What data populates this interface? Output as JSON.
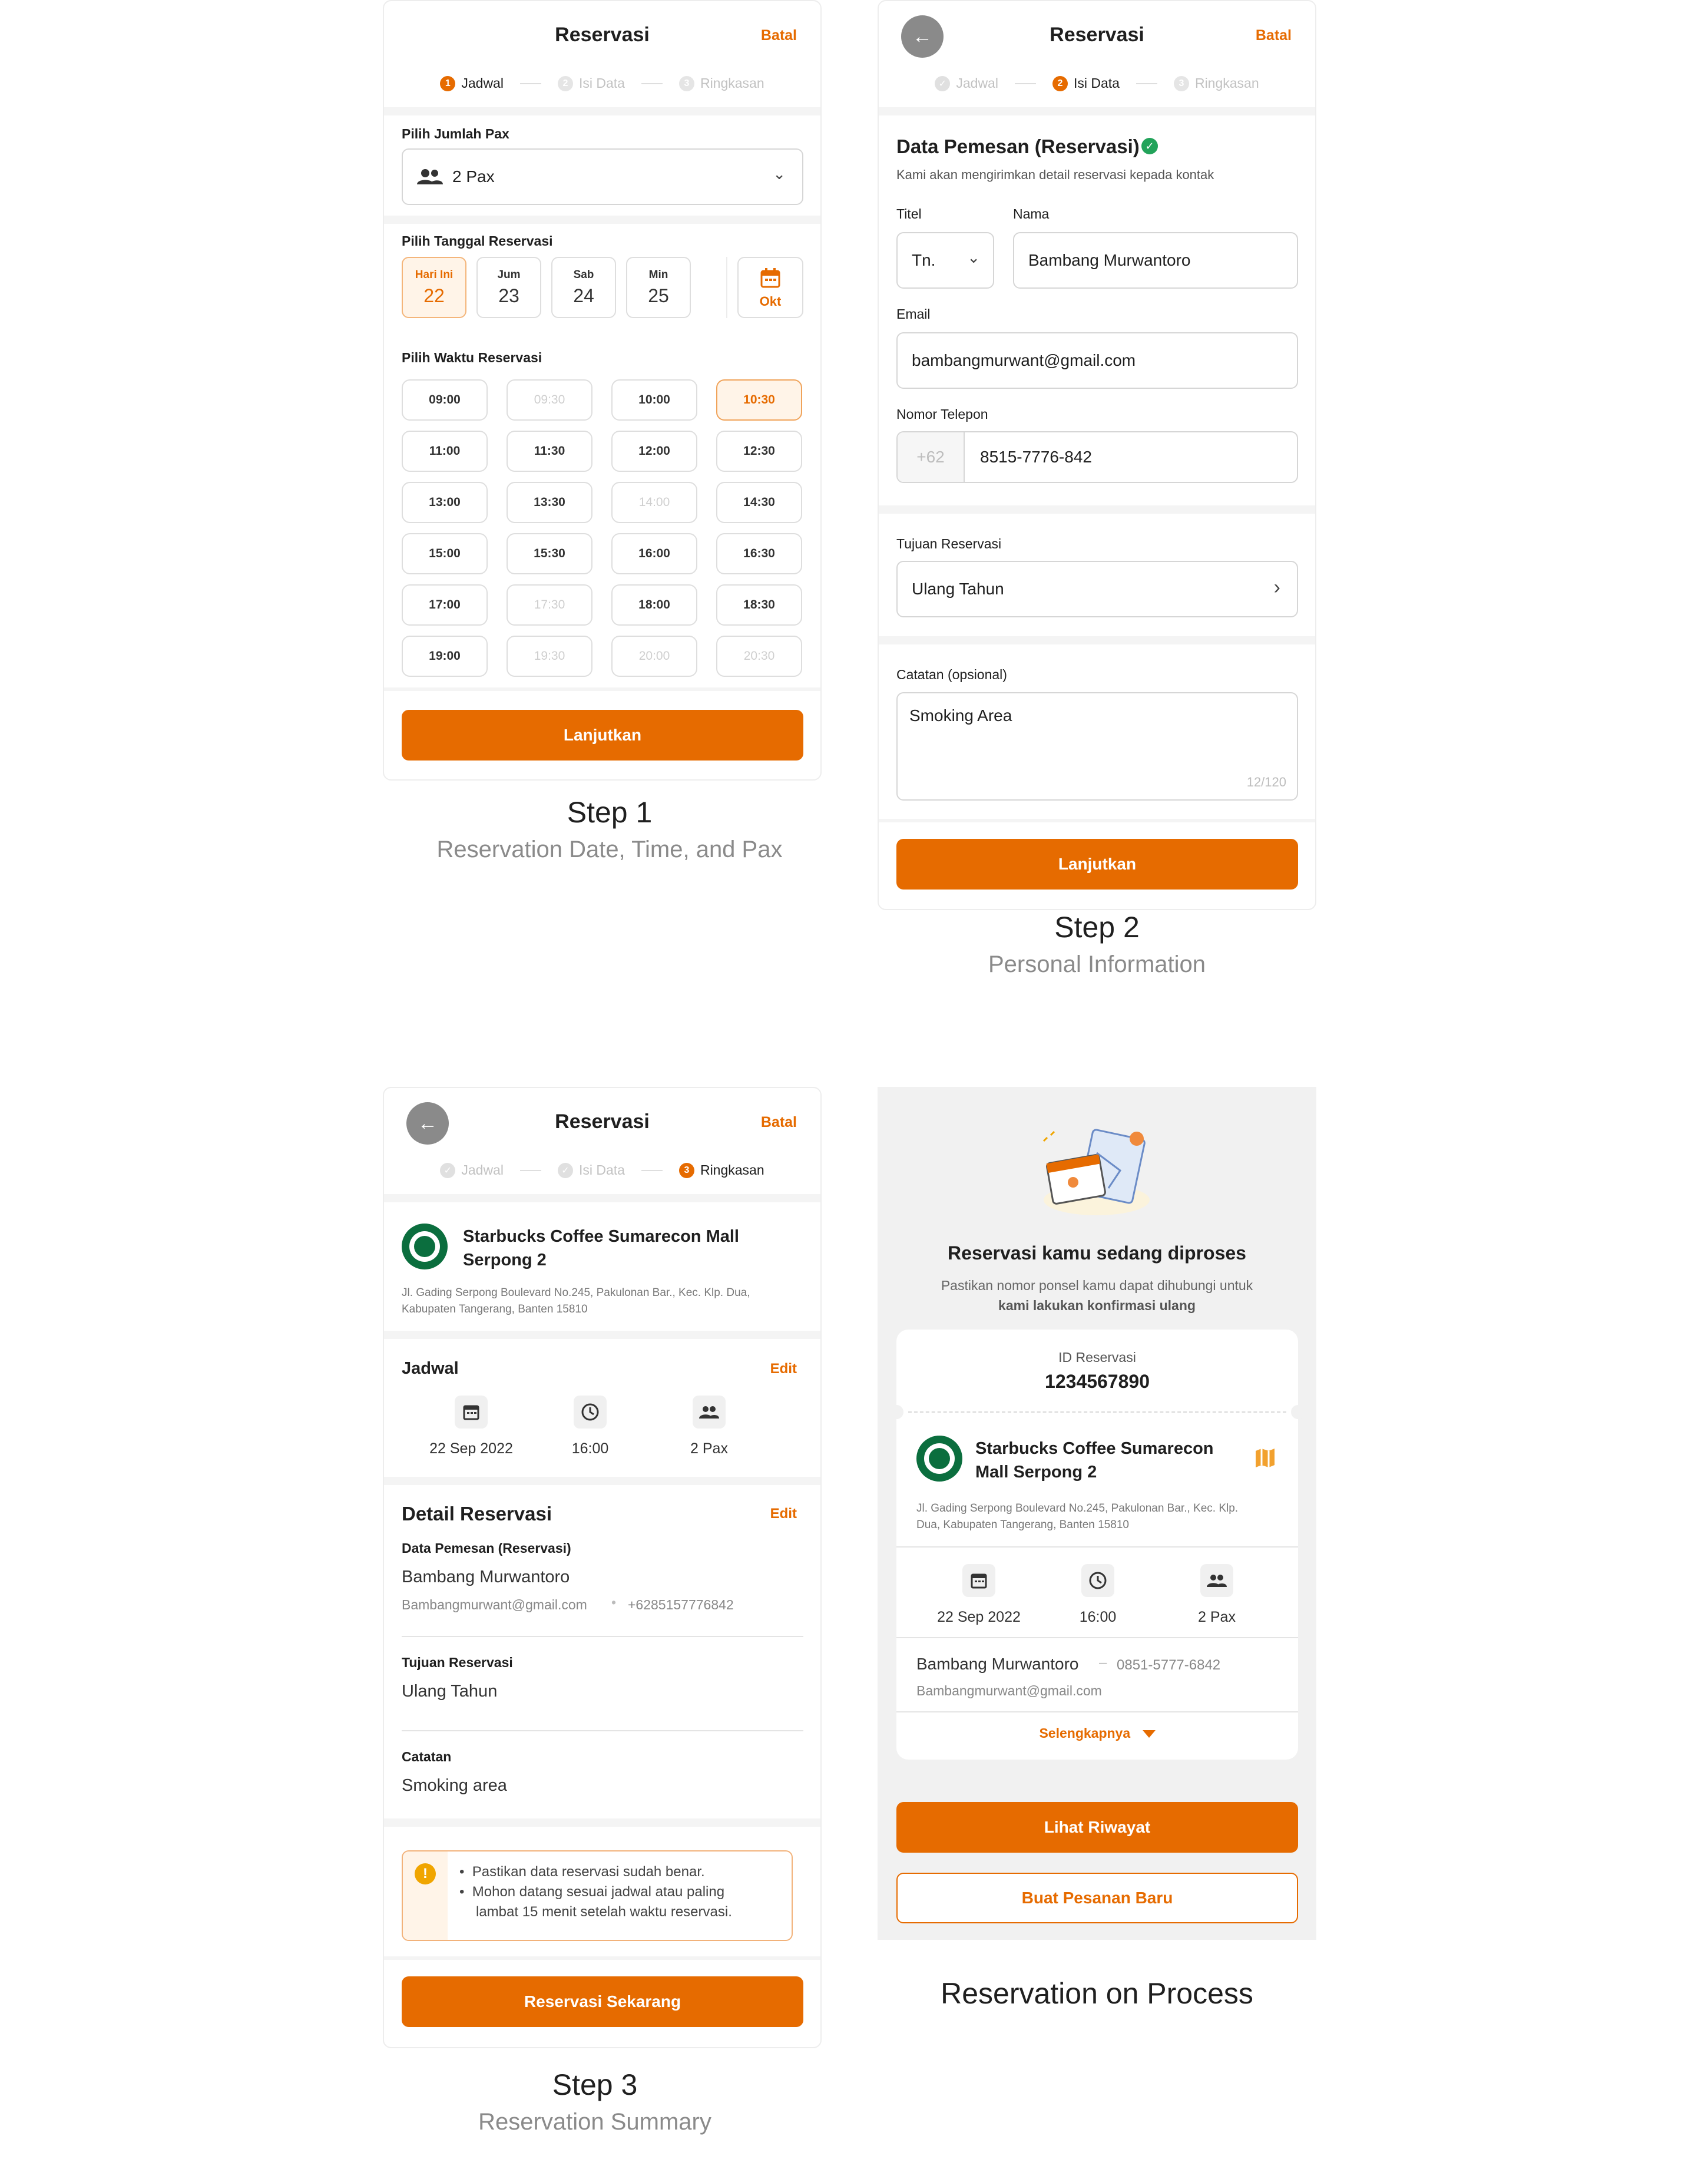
{
  "common": {
    "title": "Reservasi",
    "cancel": "Batal",
    "steps": [
      {
        "num": "1",
        "label": "Jadwal"
      },
      {
        "num": "2",
        "label": "Isi Data"
      },
      {
        "num": "3",
        "label": "Ringkasan"
      }
    ]
  },
  "step1": {
    "pax_label": "Pilih Jumlah Pax",
    "pax_value": "2 Pax",
    "date_label": "Pilih Tanggal Reservasi",
    "dates": [
      {
        "day": "Hari Ini",
        "num": "22"
      },
      {
        "day": "Jum",
        "num": "23"
      },
      {
        "day": "Sab",
        "num": "24"
      },
      {
        "day": "Min",
        "num": "25"
      }
    ],
    "month": "Okt",
    "time_label": "Pilih Waktu Reservasi",
    "times": [
      "09:00",
      "09:30",
      "10:00",
      "10:30",
      "11:00",
      "11:30",
      "12:00",
      "12:30",
      "13:00",
      "13:30",
      "14:00",
      "14:30",
      "15:00",
      "15:30",
      "16:00",
      "16:30",
      "17:00",
      "17:30",
      "18:00",
      "18:30",
      "19:00",
      "19:30",
      "20:00",
      "20:30"
    ],
    "disabled_times": [
      "09:30",
      "14:00",
      "17:30",
      "19:30",
      "20:00",
      "20:30"
    ],
    "selected_time": "10:30",
    "continue": "Lanjutkan",
    "caption_title": "Step 1",
    "caption_sub": "Reservation Date, Time, and Pax"
  },
  "step2": {
    "section_title": "Data Pemesan (Reservasi)",
    "section_sub": "Kami akan mengirimkan detail reservasi kepada kontak",
    "titel_label": "Titel",
    "titel_value": "Tn.",
    "nama_label": "Nama",
    "nama_value": "Bambang Murwantoro",
    "email_label": "Email",
    "email_value": "bambangmurwant@gmail.com",
    "phone_label": "Nomor Telepon",
    "phone_prefix": "+62",
    "phone_value": "8515-7776-842",
    "purpose_label": "Tujuan Reservasi",
    "purpose_value": "Ulang Tahun",
    "notes_label": "Catatan (opsional)",
    "notes_value": "Smoking Area",
    "notes_count": "12/120",
    "continue": "Lanjutkan",
    "caption_title": "Step 2",
    "caption_sub": "Personal Information"
  },
  "step3": {
    "store_name_1": "Starbucks Coffee Sumarecon Mall",
    "store_name_2": "Serpong 2",
    "address_1": "Jl. Gading Serpong Boulevard No.245, Pakulonan Bar., Kec. Klp. Dua,",
    "address_2": "Kabupaten Tangerang, Banten 15810",
    "schedule_title": "Jadwal",
    "edit": "Edit",
    "date": "22 Sep 2022",
    "time": "16:00",
    "pax": "2 Pax",
    "detail_title": "Detail Reservasi",
    "booker_label": "Data Pemesan (Reservasi)",
    "booker_name": "Bambang Murwantoro",
    "booker_email": "Bambangmurwant@gmail.com",
    "booker_phone": "+6285157776842",
    "purpose_label": "Tujuan Reservasi",
    "purpose_value": "Ulang Tahun",
    "notes_label": "Catatan",
    "notes_value": "Smoking area",
    "notice_1": "Pastikan data reservasi sudah benar.",
    "notice_2a": "Mohon datang sesuai jadwal atau paling",
    "notice_2b": "lambat 15 menit setelah waktu reservasi.",
    "submit": "Reservasi Sekarang",
    "caption_title": "Step 3",
    "caption_sub": "Reservation Summary"
  },
  "step4": {
    "title": "Reservasi kamu sedang diproses",
    "sub_1": "Pastikan nomor ponsel kamu dapat dihubungi untuk",
    "sub_2": "kami lakukan konfirmasi ulang",
    "id_label": "ID Reservasi",
    "id_value": "1234567890",
    "store_name_1": "Starbucks Coffee Sumarecon",
    "store_name_2": "Mall Serpong 2",
    "address_1": "Jl. Gading Serpong Boulevard No.245, Pakulonan Bar., Kec. Klp.",
    "address_2": "Dua, Kabupaten Tangerang, Banten 15810",
    "date": "22 Sep 2022",
    "time": "16:00",
    "pax": "2 Pax",
    "name": "Bambang Murwantoro",
    "phone": "0851-5777-6842",
    "email": "Bambangmurwant@gmail.com",
    "more": "Selengkapnya",
    "history": "Lihat Riwayat",
    "new_order": "Buat Pesanan Baru",
    "caption_title": "Reservation on Process"
  },
  "colors": {
    "accent": "#e66b00",
    "starbucks": "#0b6e3e"
  }
}
